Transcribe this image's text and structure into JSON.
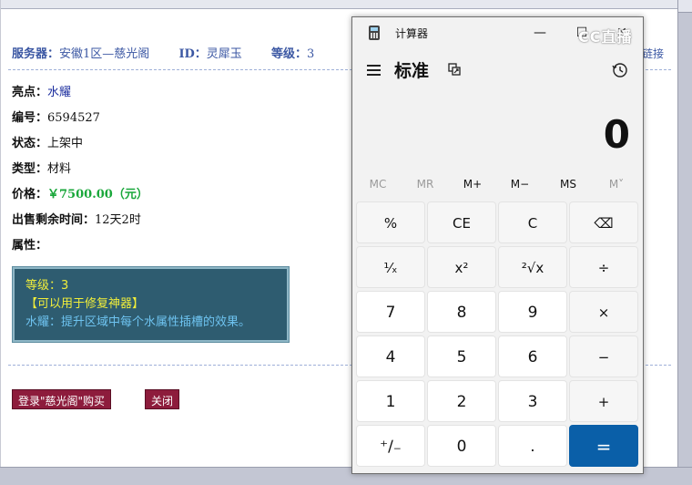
{
  "page": {
    "server_label": "服务器：",
    "server_value": "安徽1区—慈光阁",
    "id_label": "ID：",
    "id_value": "灵犀玉",
    "level_label": "等级：",
    "level_value": "3",
    "link_fragment": "链接",
    "fields": {
      "highlight_label": "亮点：",
      "highlight_value": "水耀",
      "number_label": "编号：",
      "number_value": "6594527",
      "status_label": "状态：",
      "status_value": "上架中",
      "type_label": "类型：",
      "type_value": "材料",
      "price_label": "价格：",
      "price_value": "￥7500.00（元）",
      "remaining_label": "出售剩余时间：",
      "remaining_value": "12天2时",
      "attr_label": "属性："
    },
    "attr_box": {
      "line1": "等级：3",
      "line2": "【可以用于修复神器】",
      "line3": "水耀：提升区域中每个水属性插槽的效果。"
    },
    "buy_button": "登录\"慈光阁\"购买",
    "close_button": "关闭"
  },
  "calculator": {
    "window_title": "计算器",
    "mode": "标准",
    "display_value": "0",
    "watermark": "CC直播",
    "title_buttons": {
      "minimize": "—",
      "maximize": "☐",
      "close": "✕"
    },
    "memory": [
      "MC",
      "MR",
      "M+",
      "M−",
      "MS",
      "M˅"
    ],
    "keys": [
      [
        "%",
        "CE",
        "C",
        "⌫"
      ],
      [
        "¹⁄ₓ",
        "x²",
        "²√x",
        "÷"
      ],
      [
        "7",
        "8",
        "9",
        "×"
      ],
      [
        "4",
        "5",
        "6",
        "−"
      ],
      [
        "1",
        "2",
        "3",
        "+"
      ],
      [
        "⁺∕₋",
        "0",
        ".",
        "="
      ]
    ],
    "colors": {
      "equals": "#0a5fa8"
    }
  }
}
